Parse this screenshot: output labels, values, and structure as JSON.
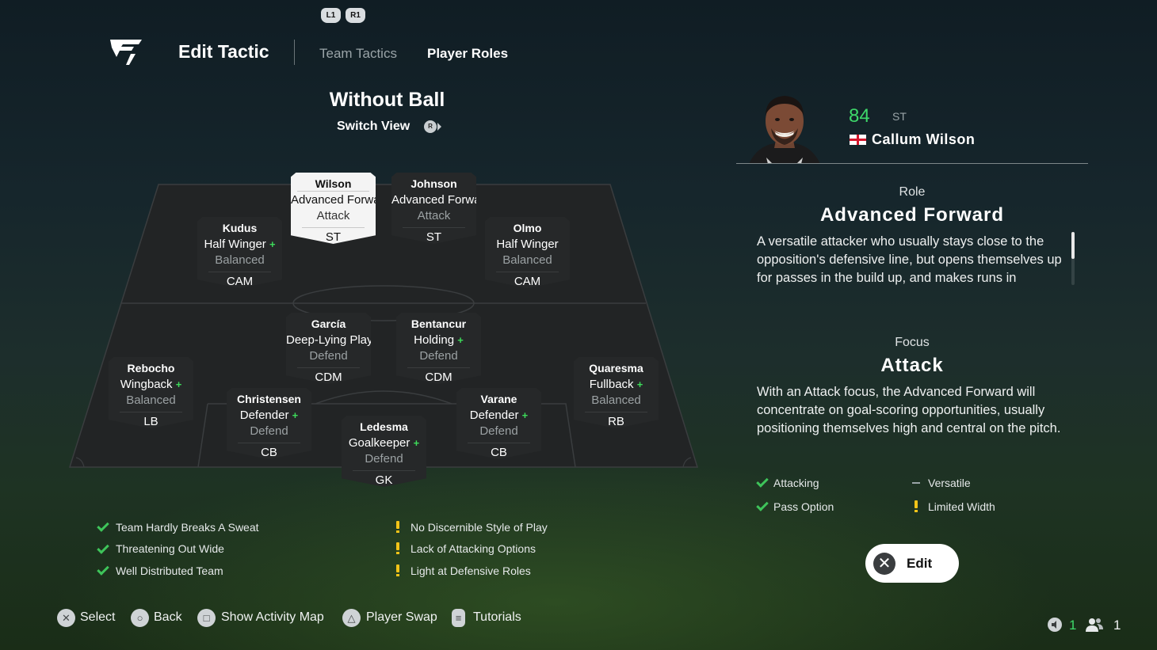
{
  "header": {
    "shoulder_left": "L1",
    "shoulder_right": "R1",
    "title": "Edit Tactic",
    "tabs": [
      {
        "label": "Team Tactics",
        "active": false
      },
      {
        "label": "Player Roles",
        "active": true
      }
    ]
  },
  "view": {
    "title": "Without Ball",
    "switch_label": "Switch View",
    "switch_button": "R"
  },
  "players": [
    {
      "name": "Wilson",
      "role": "Advanced Forward",
      "focus": "Attack",
      "position": "ST",
      "plus": false,
      "selected": true
    },
    {
      "name": "Johnson",
      "role": "Advanced Forward",
      "focus": "Attack",
      "position": "ST",
      "plus": false,
      "selected": false
    },
    {
      "name": "Kudus",
      "role": "Half Winger",
      "focus": "Balanced",
      "position": "CAM",
      "plus": true,
      "selected": false
    },
    {
      "name": "Olmo",
      "role": "Half Winger",
      "focus": "Balanced",
      "position": "CAM",
      "plus": false,
      "selected": false
    },
    {
      "name": "García",
      "role": "Deep-Lying Playmaker",
      "focus": "Defend",
      "position": "CDM",
      "plus": true,
      "selected": false
    },
    {
      "name": "Bentancur",
      "role": "Holding",
      "focus": "Defend",
      "position": "CDM",
      "plus": true,
      "selected": false
    },
    {
      "name": "Rebocho",
      "role": "Wingback",
      "focus": "Balanced",
      "position": "LB",
      "plus": true,
      "selected": false
    },
    {
      "name": "Quaresma",
      "role": "Fullback",
      "focus": "Balanced",
      "position": "RB",
      "plus": true,
      "selected": false
    },
    {
      "name": "Christensen",
      "role": "Defender",
      "focus": "Defend",
      "position": "CB",
      "plus": true,
      "selected": false
    },
    {
      "name": "Varane",
      "role": "Defender",
      "focus": "Defend",
      "position": "CB",
      "plus": true,
      "selected": false
    },
    {
      "name": "Ledesma",
      "role": "Goalkeeper",
      "focus": "Defend",
      "position": "GK",
      "plus": true,
      "selected": false
    }
  ],
  "chemistry": {
    "positives": [
      "Team Hardly Breaks A Sweat",
      "Threatening Out Wide",
      "Well Distributed Team"
    ],
    "warnings": [
      "No Discernible Style of Play",
      "Lack of Attacking Options",
      "Light at Defensive Roles"
    ]
  },
  "selected_player": {
    "rating": "84",
    "position": "ST",
    "nation": "England",
    "name": "Callum Wilson",
    "role_label": "Role",
    "role": "Advanced Forward",
    "role_description": "A versatile attacker who usually stays close to the opposition's defensive line, but opens themselves up for passes in the build up, and makes runs in",
    "focus_label": "Focus",
    "focus": "Attack",
    "focus_description": "With an Attack focus, the Advanced Forward will concentrate on goal-scoring opportunities, usually positioning themselves high and central on the pitch.",
    "attributes": [
      {
        "label": "Attacking",
        "status": "positive"
      },
      {
        "label": "Versatile",
        "status": "neutral"
      },
      {
        "label": "Pass Option",
        "status": "positive"
      },
      {
        "label": "Limited Width",
        "status": "warning"
      }
    ],
    "edit_label": "Edit"
  },
  "controls": [
    {
      "icon": "cross-button-icon",
      "glyph": "✕",
      "label": "Select"
    },
    {
      "icon": "circle-button-icon",
      "glyph": "○",
      "label": "Back"
    },
    {
      "icon": "square-button-icon",
      "glyph": "□",
      "label": "Show Activity Map"
    },
    {
      "icon": "triangle-button-icon",
      "glyph": "△",
      "label": "Player Swap"
    },
    {
      "icon": "touchpad-button-icon",
      "glyph": "≡",
      "label": "Tutorials"
    }
  ],
  "status": {
    "voice_count": "1",
    "party_count": "1"
  },
  "colors": {
    "accent_green": "#3ed86a",
    "warning_yellow": "#f2c318",
    "card_dark": "#262829",
    "card_selected": "#f4f4f4"
  }
}
